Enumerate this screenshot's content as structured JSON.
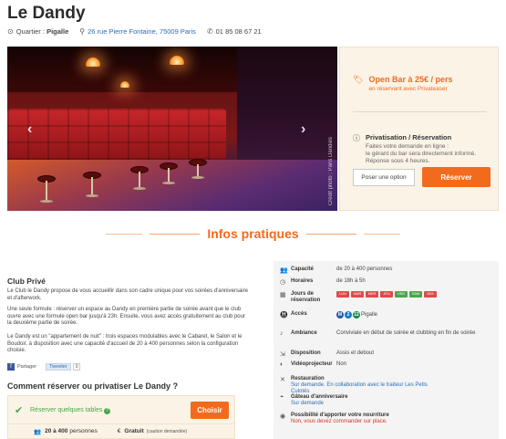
{
  "venue": {
    "name": "Le Dandy",
    "quartier_label": "Quartier :",
    "quartier": "Pigalle",
    "address": "26 rue Pierre Fontaine, 75009 Paris",
    "phone": "01 85 08 67 21"
  },
  "hero": {
    "credit": "Crédit photo : Paris Dandies",
    "prev_arrow": "‹",
    "next_arrow": "›"
  },
  "booking": {
    "offer_title": "Open Bar à 25€ / pers",
    "offer_sub": "en réservant avec Privateaser",
    "priv_title": "Privatisation / Réservation",
    "priv_desc_1": "Faites votre demande en ligne :",
    "priv_desc_2": "le gérant du bar sera directement informé.",
    "priv_desc_3": "Réponse sous 4 heures.",
    "option_label": "Poser une option",
    "reserve_label": "Réserver"
  },
  "section": {
    "title": "Infos pratiques"
  },
  "club": {
    "heading": "Club Privé",
    "p1": "Le Club le Dandy propose de vous accueillir dans son cadre unique pour vos soirées d'anniversaire et d'afterwork.",
    "p2": "Une seule formule : réserver un espace au Dandy en première partie de soirée avant que le club ouvre avec une formule open bar jusqu'à 23h. Ensuite, vous avez accès gratuitement au club pour la deuxième partie de soirée.",
    "p3": "Le Dandy est un \"appartement de nuit\" : trois espaces modulables avec le Cabaret, le Salon et le Boudoir, à disposition avec une capacité d'accueil de 20 à 400 personnes selon la configuration choisie."
  },
  "share": {
    "fb_label": "Partager",
    "tw_label": "Tweeter",
    "count": "0"
  },
  "how": {
    "heading": "Comment réserver ou privatiser Le Dandy ?",
    "option": "Réserver quelques tables",
    "choose_label": "Choisir",
    "capacity": "20 à 400",
    "capacity_unit": "personnes",
    "price": "Gratuit",
    "price_note": "(caution demandée)"
  },
  "info": {
    "capacity_label": "Capacité",
    "capacity_value": "de 20 à 400 personnes",
    "hours_label": "Horaires",
    "hours_value": "de 18h à 5h",
    "days_label": "Jours de réservation",
    "days": [
      {
        "label": "LUN",
        "color": "#e24a4a"
      },
      {
        "label": "MAR",
        "color": "#e24a4a"
      },
      {
        "label": "MER",
        "color": "#e24a4a"
      },
      {
        "label": "JEU",
        "color": "#e24a4a"
      },
      {
        "label": "VEN",
        "color": "#4aa84a"
      },
      {
        "label": "SAM",
        "color": "#4aa84a"
      },
      {
        "label": "DIM",
        "color": "#e24a4a"
      }
    ],
    "access_label": "Accès",
    "metro_lines": [
      {
        "label": "M",
        "color": "#2a5aa5"
      },
      {
        "label": "2",
        "color": "#1a7ac0"
      },
      {
        "label": "12",
        "color": "#1a8a4a"
      }
    ],
    "access_value": "Pigalle",
    "ambiance_label": "Ambiance",
    "ambiance_value": "Conviviale en début de soirée et clubbing en fin de soirée",
    "disposition_label": "Disposition",
    "disposition_value": "Assis et debout",
    "video_label": "Vidéoprojecteur",
    "video_value": "Non",
    "restauration_label": "Restauration",
    "restauration_value": "Sur demande. En collaboration avec le traiteur Les Petis Culotés",
    "gateau_label": "Gâteau d'anniversaire",
    "gateau_value": "Sur demande",
    "food_label": "Possibilité d'apporter votre nourriture",
    "food_value": "Non, vous devez commander sur place."
  },
  "colors": {
    "accent": "#f26b1d",
    "panel_bg": "#fbf3e6",
    "link": "#2a6fb5",
    "green": "#48a84a"
  }
}
